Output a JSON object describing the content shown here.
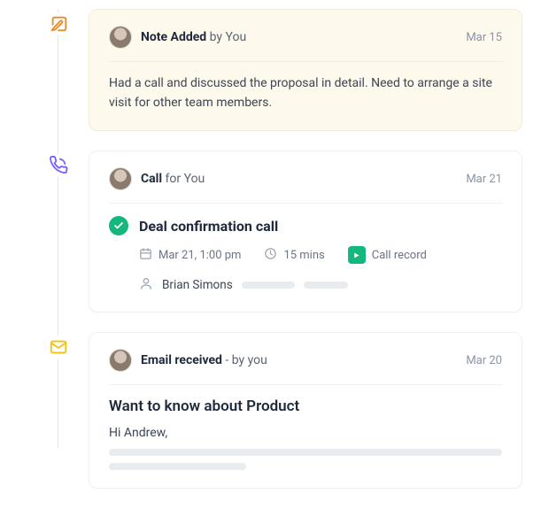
{
  "timeline": [
    {
      "type": "note",
      "header_strong": "Note Added",
      "header_tail": " by You",
      "date": "Mar 15",
      "body": "Had a call and discussed the proposal in detail. Need to arrange a site visit for other team members."
    },
    {
      "type": "call",
      "header_strong": "Call",
      "header_tail": " for You",
      "date": "Mar 21",
      "title": "Deal confirmation call",
      "datetime": "Mar 21, 1:00 pm",
      "duration": "15 mins",
      "record_label": "Call record",
      "contact": "Brian Simons"
    },
    {
      "type": "email",
      "header_strong": "Email received",
      "header_tail": " - by you",
      "date": "Mar 20",
      "subject": "Want to know about Product",
      "greeting": "Hi Andrew,"
    }
  ]
}
